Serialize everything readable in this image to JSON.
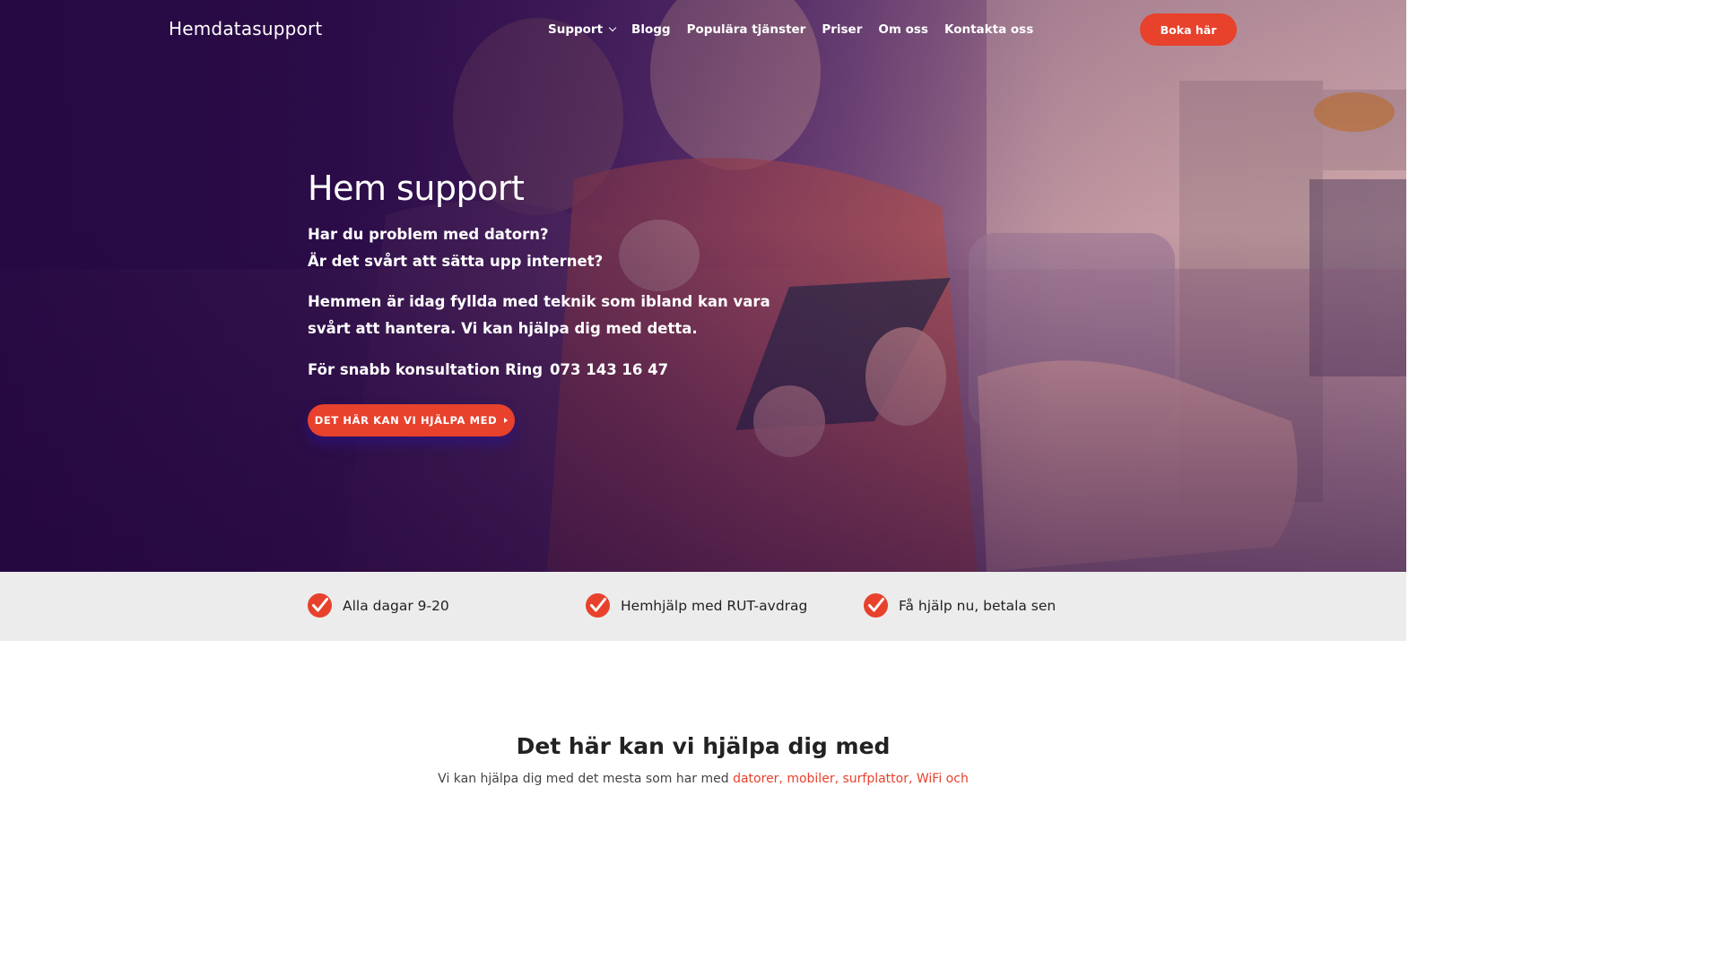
{
  "header": {
    "logo": "Hemdatasupport",
    "nav": [
      {
        "label": "Support"
      },
      {
        "label": "Blogg"
      },
      {
        "label": "Populära tjänster"
      },
      {
        "label": "Priser"
      },
      {
        "label": "Om oss"
      },
      {
        "label": "Kontakta oss"
      }
    ],
    "book_button": "Boka här"
  },
  "hero": {
    "title": "Hem support",
    "question_1": "Har du problem med datorn?",
    "question_2": "Är det svårt att sätta upp internet?",
    "paragraph_line_1": "Hemmen är idag fyllda med teknik som ibland kan vara",
    "paragraph_line_2": "svårt att hantera. Vi kan hjälpa dig med detta.",
    "call_text": "För snabb konsultation Ring",
    "phone": "073 143 16 47",
    "cta_button": "DET HÄR KAN VI HJÄLPA MED"
  },
  "features": [
    {
      "label": "Alla dagar 9-20",
      "icon": "check-circle-icon"
    },
    {
      "label": "Hemhjälp med RUT-avdrag",
      "icon": "check-circle-icon"
    },
    {
      "label": "Få hjälp nu, betala sen",
      "icon": "check-circle-icon"
    }
  ],
  "section": {
    "title": "Det här kan vi hjälpa dig med",
    "subtitle_prefix": "Vi kan hjälpa dig med det mesta som har med",
    "subtitle_highlight": "datorer, mobiler, surfplattor, WiFi och"
  },
  "colors": {
    "accent": "#e8412c",
    "hero_purple": "#2a0f45",
    "feature_bar": "#ececec"
  }
}
